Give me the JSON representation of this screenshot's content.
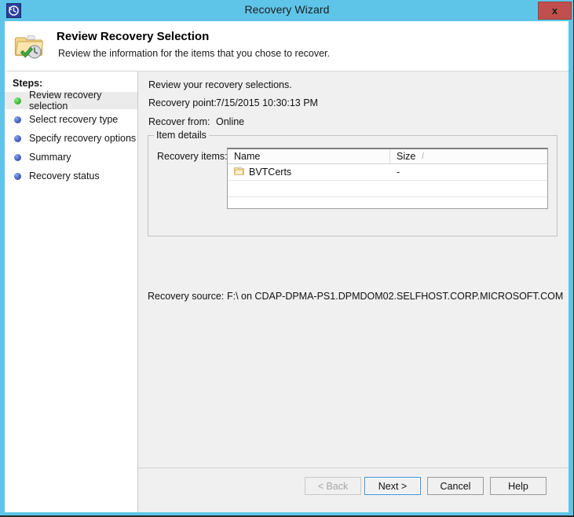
{
  "window": {
    "title": "Recovery Wizard",
    "title_icon": "recovery-clock-icon",
    "close_label": "x",
    "accent_color": "#5FC5E8",
    "close_color": "#c0504d"
  },
  "header": {
    "icon": "folder-clock-icon",
    "title": "Review Recovery Selection",
    "subtitle": "Review the information for the items that you chose to recover."
  },
  "sidebar": {
    "label": "Steps:",
    "items": [
      {
        "label": "Review recovery selection",
        "state": "current",
        "bullet_color": "#3fc23b"
      },
      {
        "label": "Select recovery type",
        "state": "pending",
        "bullet_color": "#4a62c4"
      },
      {
        "label": "Specify recovery options",
        "state": "pending",
        "bullet_color": "#4a62c4"
      },
      {
        "label": "Summary",
        "state": "pending",
        "bullet_color": "#4a62c4"
      },
      {
        "label": "Recovery status",
        "state": "pending",
        "bullet_color": "#4a62c4"
      }
    ]
  },
  "main": {
    "intro": "Review your recovery selections.",
    "recovery_point_label": "Recovery point:",
    "recovery_point_value": "7/15/2015 10:30:13 PM",
    "recover_from_label": "Recover from:",
    "recover_from_value": "Online",
    "group_title": "Item details",
    "recovery_items_label": "Recovery items:",
    "table": {
      "columns": [
        "Name",
        "Size"
      ],
      "sort_glyph": "/",
      "rows": [
        {
          "icon": "folder-icon",
          "name": "BVTCerts",
          "size": "-"
        }
      ]
    },
    "recovery_source_label": "Recovery source:",
    "recovery_source_value": "F:\\ on CDAP-DPMA-PS1.DPMDOM02.SELFHOST.CORP.MICROSOFT.COM"
  },
  "footer": {
    "back": "< Back",
    "next": "Next >",
    "cancel": "Cancel",
    "help": "Help"
  }
}
